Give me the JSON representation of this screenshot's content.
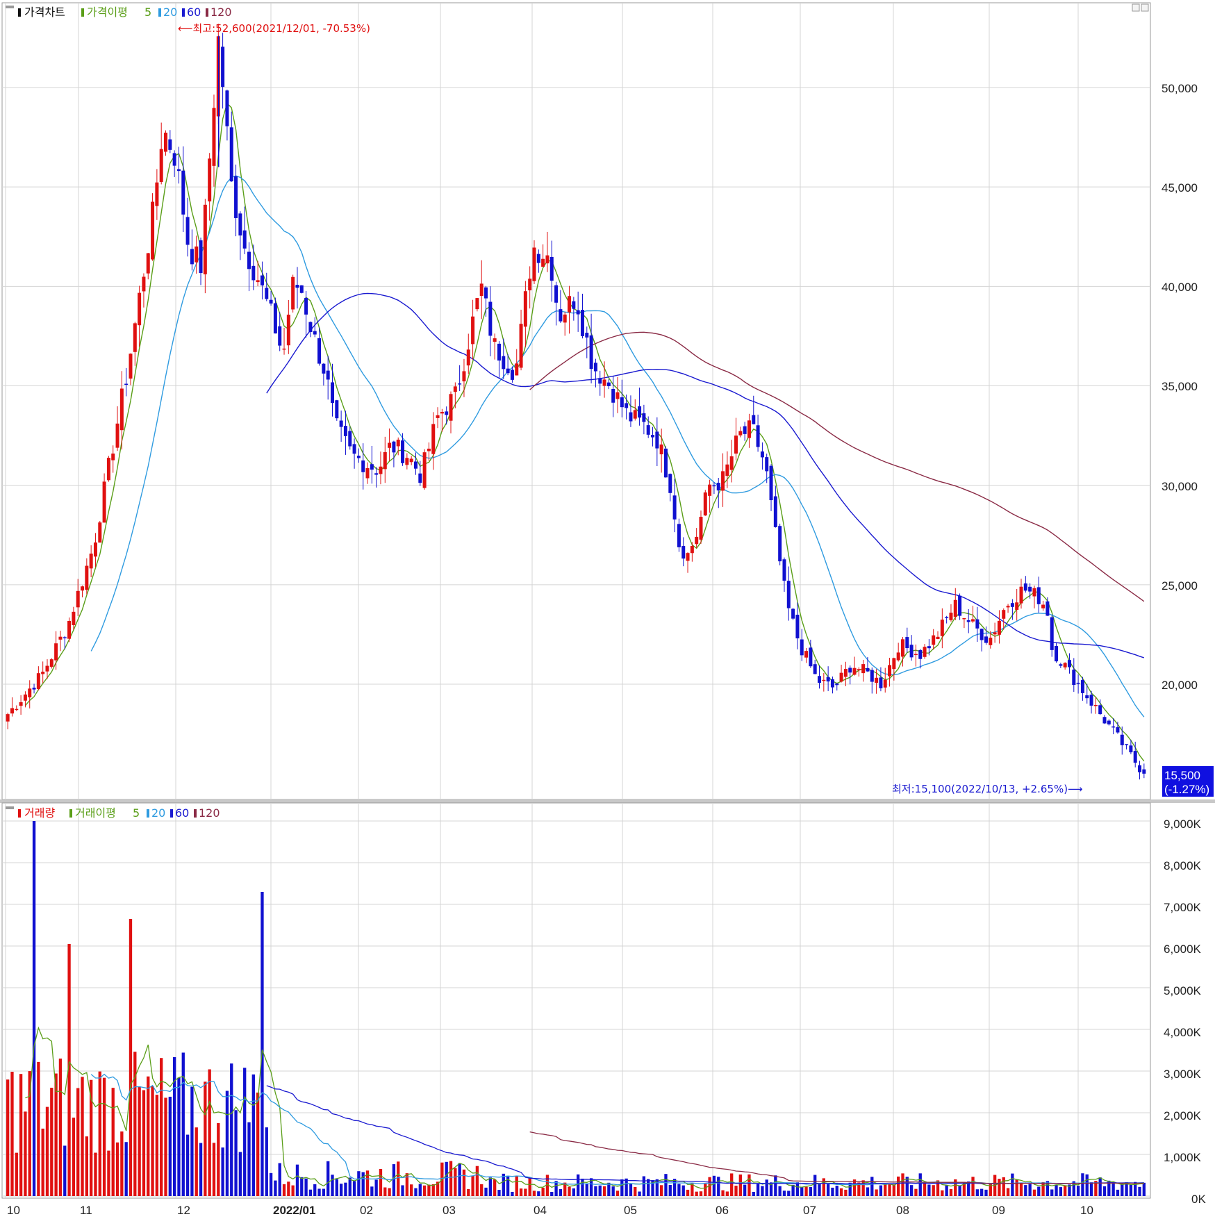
{
  "colors": {
    "up": "#e01010",
    "down": "#1010d0",
    "ma5": "#5a9e18",
    "ma20": "#2f9be0",
    "ma60": "#1a1ad0",
    "ma120": "#8a2a45",
    "grid": "#d4d4d4",
    "price_badge_bg": "#1010e0"
  },
  "price_panel": {
    "legend": {
      "title": "가격차트",
      "ma_label": "가격이평",
      "p5": "5",
      "p20": "20",
      "p60": "60",
      "p120": "120"
    },
    "high_annotation": "⟵최고:52,600(2021/12/01, -70.53%)",
    "low_annotation": "최저:15,100(2022/10/13, +2.65%)⟶",
    "last_price": "15,500",
    "last_change": "(-1.27%)",
    "y_ticks": [
      "50,000",
      "45,000",
      "40,000",
      "35,000",
      "30,000",
      "25,000",
      "20,000"
    ]
  },
  "volume_panel": {
    "legend": {
      "title": "거래량",
      "ma_label": "거래이평",
      "p5": "5",
      "p20": "20",
      "p60": "60",
      "p120": "120"
    },
    "y_ticks": [
      "9,000K",
      "8,000K",
      "7,000K",
      "6,000K",
      "5,000K",
      "4,000K",
      "3,000K",
      "2,000K",
      "1,000K",
      "0K"
    ]
  },
  "x_axis": {
    "labels": [
      "10",
      "11",
      "12",
      "2022/01",
      "02",
      "03",
      "04",
      "05",
      "06",
      "07",
      "08",
      "09",
      "10"
    ]
  },
  "chart_data": [
    {
      "type": "candlestick",
      "title": "가격차트",
      "ylim": [
        15100,
        52600
      ],
      "y_ticks": [
        20000,
        25000,
        30000,
        35000,
        40000,
        45000,
        50000
      ],
      "x_range": [
        "2021-10",
        "2022-10"
      ],
      "anchors": [
        {
          "x": "2021-10 start",
          "price": 18500
        },
        {
          "x": "2021-11 mid",
          "price": 48000
        },
        {
          "x": "2021-12-01",
          "price": 52600,
          "note": "high"
        },
        {
          "x": "2021-12 end",
          "price": 40000
        },
        {
          "x": "2022-01 end",
          "price": 30800
        },
        {
          "x": "2022-03 end",
          "price": 42000
        },
        {
          "x": "2022-04 end",
          "price": 32300
        },
        {
          "x": "2022-05 mid",
          "price": 26500
        },
        {
          "x": "2022-06 start",
          "price": 32000
        },
        {
          "x": "2022-06 end",
          "price": 20000
        },
        {
          "x": "2022-08 start",
          "price": 24500
        },
        {
          "x": "2022-09 end",
          "price": 19500
        },
        {
          "x": "2022-10-13",
          "price": 15100,
          "note": "low"
        },
        {
          "x": "last",
          "price": 15500,
          "change_pct": -1.27
        }
      ],
      "moving_averages": [
        "5",
        "20",
        "60",
        "120"
      ]
    },
    {
      "type": "bar",
      "title": "거래량",
      "ylim": [
        0,
        9500000
      ],
      "y_ticks": [
        0,
        1000000,
        2000000,
        3000000,
        4000000,
        5000000,
        6000000,
        7000000,
        8000000,
        9000000
      ],
      "peaks": [
        {
          "x": "2021-10",
          "value": 9000000
        },
        {
          "x": "2021-12",
          "value": 7300000
        },
        {
          "x": "2021-11",
          "value": 6650000
        },
        {
          "x": "2021-10",
          "value": 6050000
        }
      ],
      "moving_averages": [
        "5",
        "20",
        "60",
        "120"
      ]
    }
  ]
}
